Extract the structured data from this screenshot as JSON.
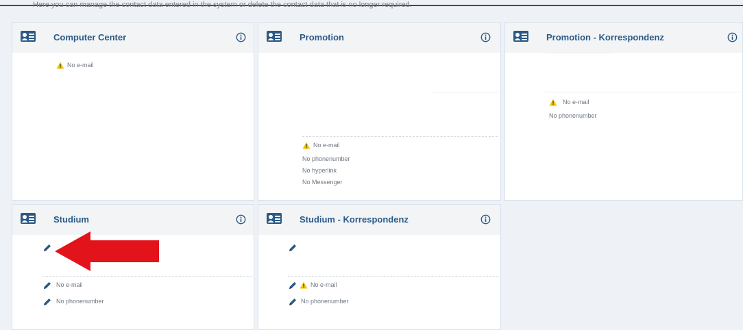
{
  "intro_text": "Here you can manage the contact data entered in the system or delete the contact data that is no longer required.",
  "cards": [
    {
      "title": "Computer Center",
      "lines": [
        "No e-mail"
      ]
    },
    {
      "title": "Promotion",
      "lines": [
        "No e-mail",
        "No phonenumber",
        "No hyperlink",
        "No Messenger"
      ]
    },
    {
      "title": "Promotion - Korrespondenz",
      "lines": [
        "No e-mail",
        "No phonenumber"
      ]
    },
    {
      "title": "Studium",
      "lines": [
        "No e-mail",
        "No phonenumber"
      ]
    },
    {
      "title": "Studium - Korrespondenz",
      "lines": [
        "No e-mail",
        "No phonenumber"
      ]
    }
  ],
  "colors": {
    "accent": "#2a5a86",
    "top_line": "#8a2b3b",
    "warning": "#f5c400",
    "arrow": "#e3131b"
  },
  "icons": {
    "card": "contact-card-icon",
    "info": "info-icon",
    "warning": "warning-icon",
    "edit": "pencil-icon",
    "arrow": "red-arrow"
  }
}
